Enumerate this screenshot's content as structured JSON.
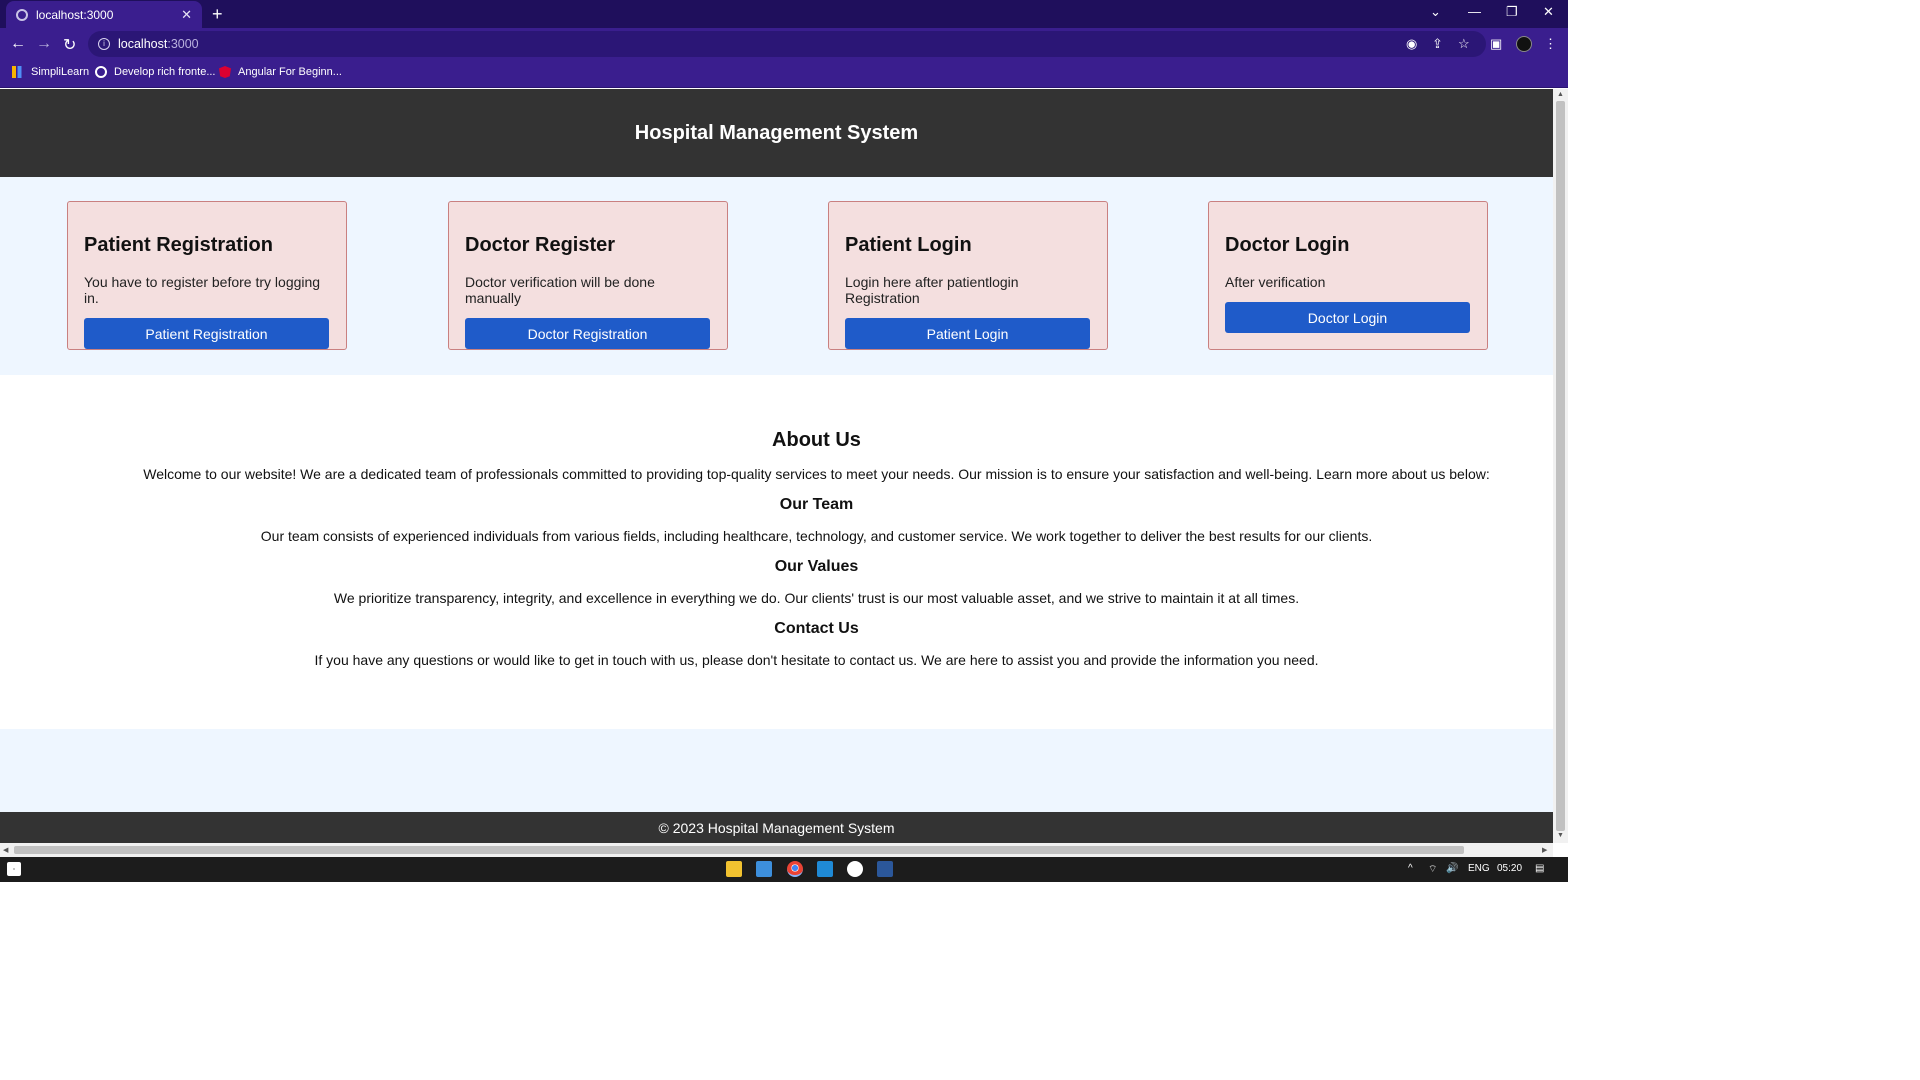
{
  "browser": {
    "tab_title": "localhost:3000",
    "tab_close": "✕",
    "new_tab": "+",
    "address_host": "localhost",
    "address_port": ":3000",
    "bookmarks": [
      "SimpliLearn",
      "Develop rich fronte...",
      "Angular For Beginn..."
    ]
  },
  "header": {
    "title": "Hospital Management System"
  },
  "cards": [
    {
      "title": "Patient Registration",
      "text": "You have to register before try logging in.",
      "button": "Patient Registration"
    },
    {
      "title": "Doctor Register",
      "text": "Doctor verification will be done manually",
      "button": "Doctor Registration"
    },
    {
      "title": "Patient Login",
      "text": "Login here after patientlogin Registration",
      "button": "Patient Login"
    },
    {
      "title": "Doctor Login",
      "text": "After verification",
      "button": "Doctor Login"
    }
  ],
  "about": {
    "title": "About Us",
    "intro": "Welcome to our website! We are a dedicated team of professionals committed to providing top-quality services to meet your needs. Our mission is to ensure your satisfaction and well-being. Learn more about us below:",
    "team_title": "Our Team",
    "team_text": "Our team consists of experienced individuals from various fields, including healthcare, technology, and customer service. We work together to deliver the best results for our clients.",
    "values_title": "Our Values",
    "values_text": "We prioritize transparency, integrity, and excellence in everything we do. Our clients' trust is our most valuable asset, and we strive to maintain it at all times.",
    "contact_title": "Contact Us",
    "contact_text": "If you have any questions or would like to get in touch with us, please don't hesitate to contact us. We are here to assist you and provide the information you need."
  },
  "footer": {
    "text": "© 2023 Hospital Management System"
  },
  "taskbar": {
    "language": "ENG",
    "time": "05:20"
  },
  "colors": {
    "header_bg": "#333333",
    "card_bg": "#f4dfdf",
    "button_bg": "#1f5bc9",
    "section_bg": "#eef6ff"
  }
}
